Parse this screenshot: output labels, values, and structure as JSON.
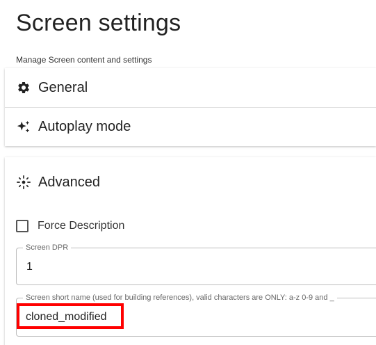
{
  "header": {
    "title": "Screen settings",
    "subtitle": "Manage Screen content and settings"
  },
  "sections": {
    "general": {
      "label": "General",
      "icon": "gear-icon"
    },
    "autoplay": {
      "label": "Autoplay mode",
      "icon": "sparkle-icon"
    },
    "advanced": {
      "label": "Advanced",
      "icon": "light-icon"
    }
  },
  "advanced": {
    "force_description": {
      "label": "Force Description",
      "checked": false
    },
    "screen_dpr": {
      "label": "Screen DPR",
      "value": "1"
    },
    "short_name": {
      "label": "Screen short name (used for building references), valid characters are ONLY: a-z 0-9 and _",
      "value": "cloned_modified"
    }
  },
  "colors": {
    "highlight": "#ff0000",
    "text": "#222222",
    "border": "#bdbdbd"
  }
}
